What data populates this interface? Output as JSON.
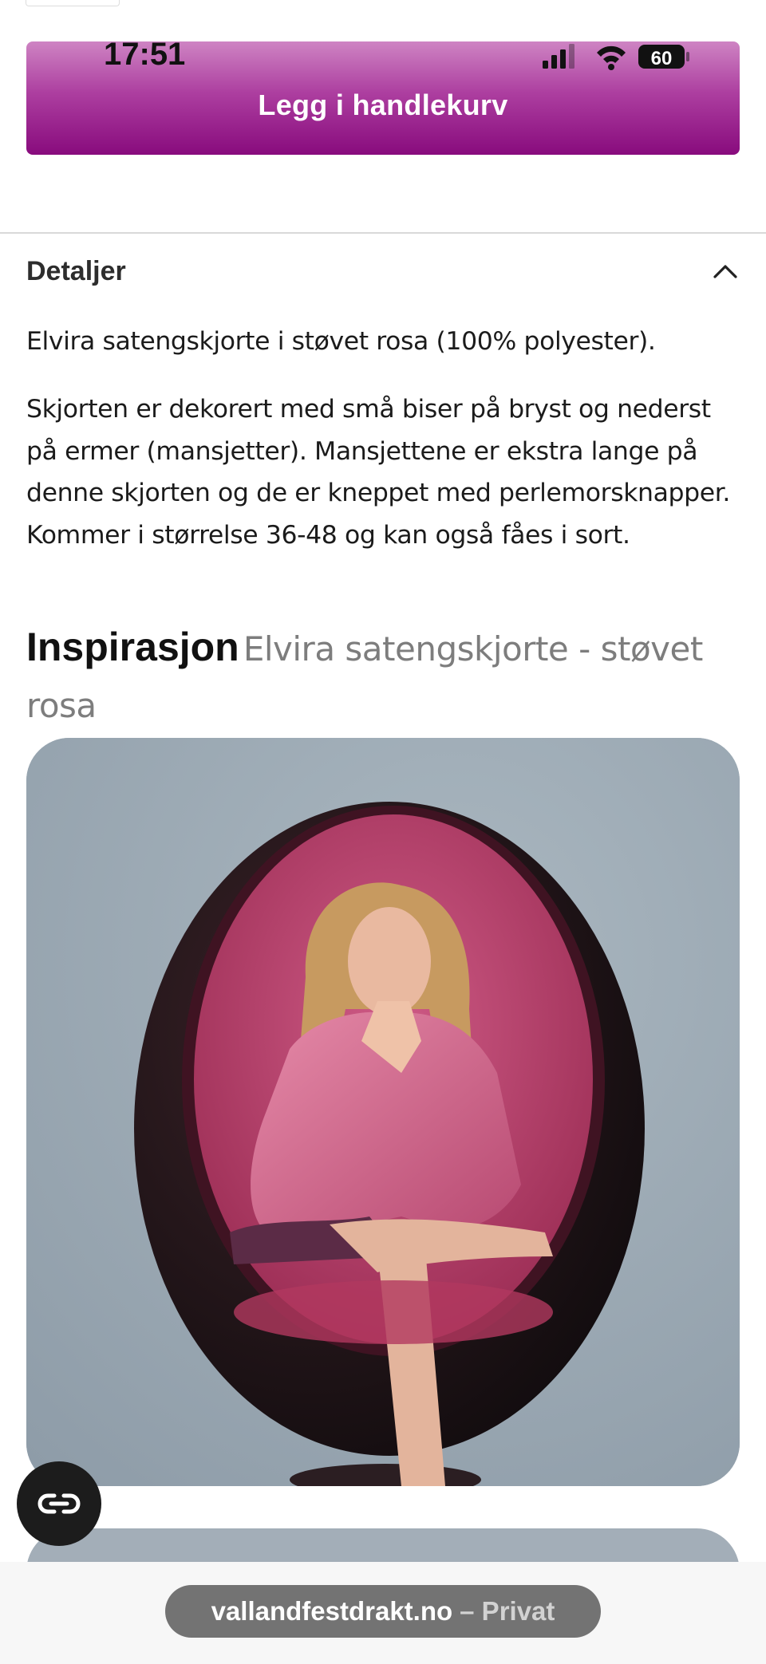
{
  "status_bar": {
    "time": "17:51",
    "battery": "60"
  },
  "cart_button": {
    "label": "Legg i handlekurv"
  },
  "details": {
    "title": "Detaljer",
    "paragraph1": "Elvira satengskjorte i støvet rosa (100% polyester).",
    "paragraph2": "Skjorten er dekorert med små biser på bryst og nederst på ermer (mansjetter). Mansjettene er ekstra lange på denne skjorten og de er kneppet med perlemorsknapper. Kommer i størrelse 36-48 og kan også fåes i sort."
  },
  "inspiration": {
    "title": "Inspirasjon",
    "subtitle": "Elvira satengskjorte - støvet rosa"
  },
  "browser": {
    "domain": "vallandfestdrakt.no",
    "mode": "– Privat"
  },
  "colors": {
    "cart_button_top": "#ce84c3",
    "cart_button_bottom": "#880b7d",
    "chair_interior": "#c24a7a",
    "backdrop": "#9eabb5"
  }
}
